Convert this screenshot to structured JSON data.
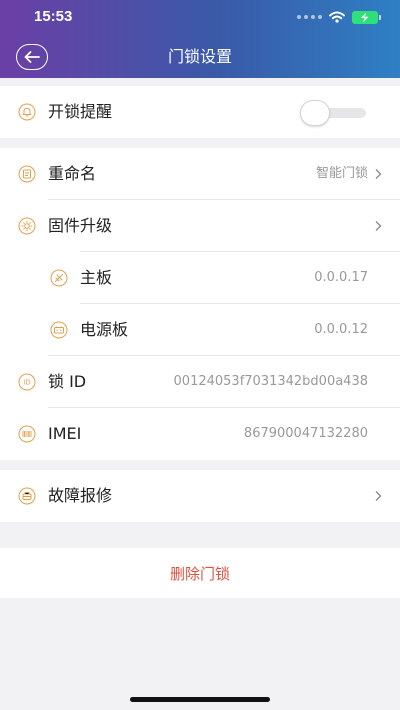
{
  "status_bar": {
    "time": "15:53"
  },
  "header": {
    "title": "门锁设置"
  },
  "colors": {
    "accent_icon": "#e0a050",
    "delete_text": "#e0523f",
    "header_gradient": [
      "#6b3fa6",
      "#3a5aa8",
      "#2f7fc4"
    ]
  },
  "settings": {
    "unlock_reminder": {
      "label": "开锁提醒",
      "enabled": false,
      "icon": "bell-icon"
    },
    "rename": {
      "label": "重命名",
      "value": "智能门锁",
      "icon": "edit-icon"
    },
    "firmware_upgrade": {
      "label": "固件升级",
      "icon": "gear-icon"
    },
    "mainboard": {
      "label": "主板",
      "value": "0.0.0.17",
      "icon": "chip-icon"
    },
    "power_board": {
      "label": "电源板",
      "value": "0.0.0.12",
      "icon": "battery-icon"
    },
    "lock_id": {
      "label": "锁 ID",
      "value": "00124053f7031342bd00a438",
      "icon": "id-icon"
    },
    "imei": {
      "label": "IMEI",
      "value": "867900047132280",
      "icon": "barcode-icon"
    },
    "repair": {
      "label": "故障报修",
      "icon": "repair-icon"
    }
  },
  "delete_button": {
    "label": "删除门锁"
  }
}
